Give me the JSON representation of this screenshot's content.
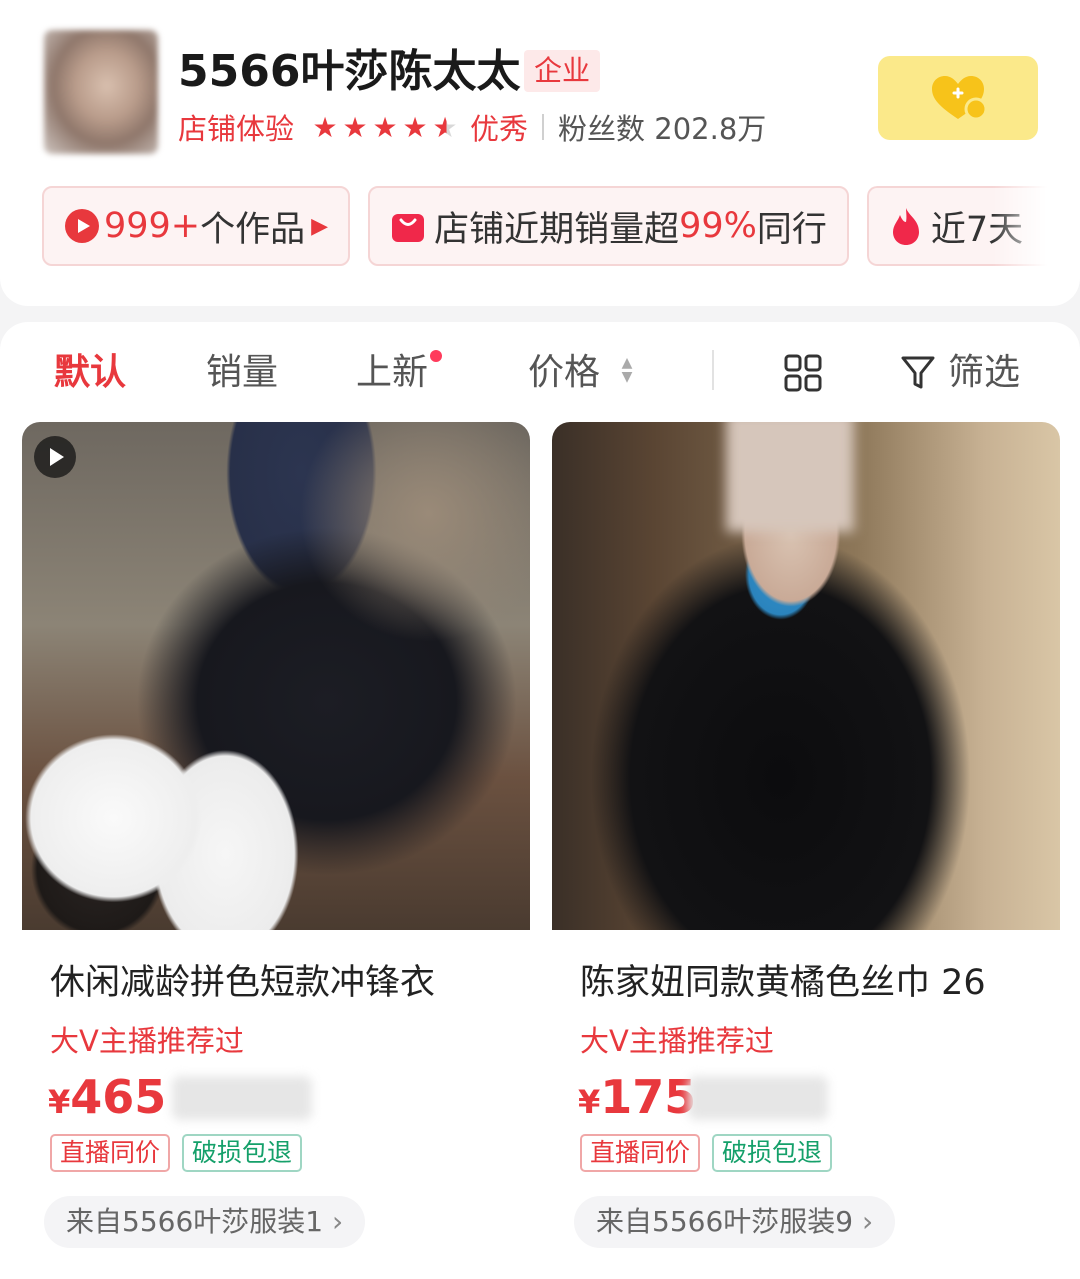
{
  "shop": {
    "name": "5566叶莎陈太太",
    "badge": "企业",
    "experience_label": "店铺体验",
    "rating_stars": 4.5,
    "rating_text": "优秀",
    "fans": "粉丝数 202.8万"
  },
  "pills": [
    {
      "count": "999+",
      "text": "个作品"
    },
    {
      "text_before": "店铺近期销量超",
      "highlight": "99%",
      "text_after": "同行"
    },
    {
      "text": "近7天"
    }
  ],
  "sort_bar": {
    "tabs": [
      "默认",
      "销量",
      "上新",
      "价格"
    ],
    "active_tab": "默认",
    "filter_label": "筛选"
  },
  "products": [
    {
      "title": "休闲减龄拼色短款冲锋衣",
      "recommend": "大V主播推荐过",
      "currency": "¥",
      "price": "465",
      "tags": [
        "直播同价",
        "破损包退"
      ],
      "source": "来自5566叶莎服装1",
      "has_video": true
    },
    {
      "title": "陈家妞同款黄橘色丝巾 26",
      "recommend": "大V主播推荐过",
      "currency": "¥",
      "price": "175",
      "tags": [
        "直播同价",
        "破损包退"
      ],
      "source": "来自5566叶莎服装9",
      "has_video": false
    }
  ],
  "colors": {
    "accent": "#e8383d",
    "follow_bg": "#fbe98a",
    "tag_green": "#15a06a"
  }
}
